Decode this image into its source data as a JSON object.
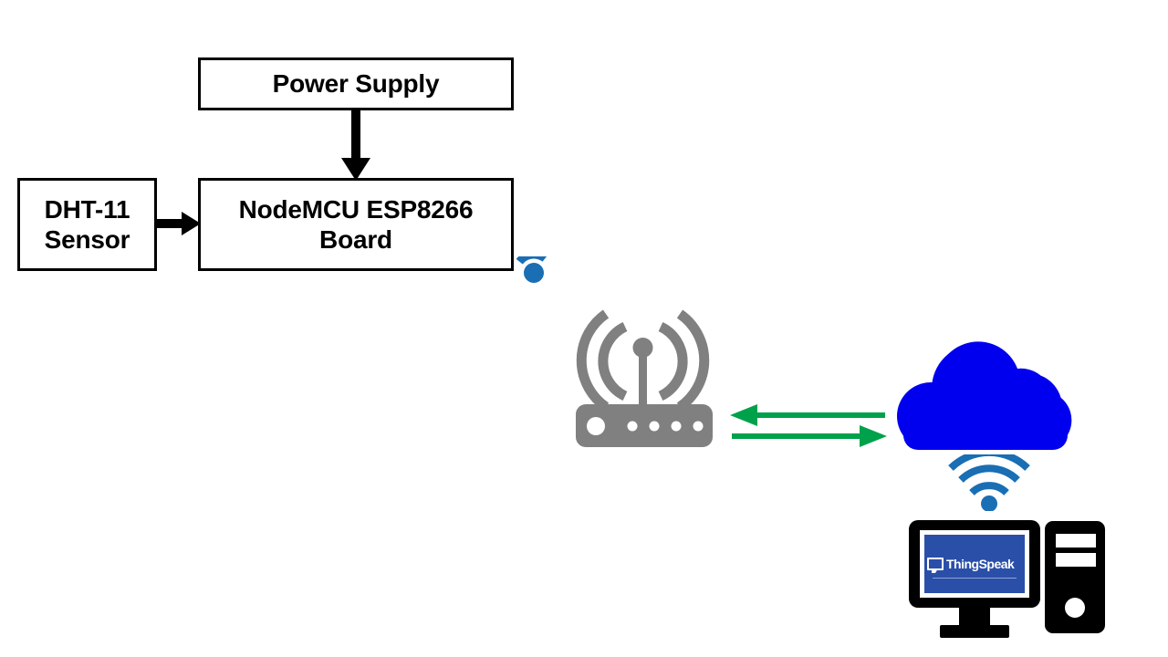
{
  "diagram": {
    "title": "IoT temperature and humidity monitoring block diagram",
    "background_color": "#ffffff",
    "blocks": [
      {
        "id": "power_supply",
        "label": "Power Supply",
        "border_color": "#000000",
        "fill_color": "#ffffff"
      },
      {
        "id": "dht11_sensor",
        "label": "DHT-11\nSensor",
        "border_color": "#000000",
        "fill_color": "#ffffff"
      },
      {
        "id": "nodemcu_board",
        "label": "NodeMCU ESP8266\nBoard",
        "border_color": "#000000",
        "fill_color": "#ffffff"
      }
    ],
    "connectors": [
      {
        "id": "power-to-nodemcu",
        "from": "power_supply",
        "to": "nodemcu_board",
        "direction": "down",
        "color": "#000000"
      },
      {
        "id": "dht-to-nodemcu",
        "from": "dht11_sensor",
        "to": "nodemcu_board",
        "direction": "right",
        "color": "#000000"
      },
      {
        "id": "cloud-to-router",
        "from": "thingspeak_cloud",
        "to": "wifi_router",
        "direction": "left",
        "color": "#00a14b"
      },
      {
        "id": "router-to-cloud",
        "from": "wifi_router",
        "to": "thingspeak_cloud",
        "direction": "right",
        "color": "#00a14b"
      }
    ],
    "icons": [
      {
        "id": "esp_wifi_signal",
        "name": "wifi-signal-icon",
        "color": "#1a6eb4",
        "arcs": 3
      },
      {
        "id": "wifi_router",
        "name": "wifi-router-icon",
        "color": "#808080",
        "antenna_arcs": 4,
        "status_lights": 5
      },
      {
        "id": "thingspeak_cloud",
        "name": "cloud-icon",
        "color": "#0000ee"
      },
      {
        "id": "cloud_wifi_signal",
        "name": "wifi-signal-icon",
        "color": "#1a6eb4",
        "arcs": 3
      },
      {
        "id": "desktop_monitor",
        "name": "computer-monitor-icon",
        "color": "#000000",
        "screen_color": "#2a4fa8"
      },
      {
        "id": "desktop_tower",
        "name": "computer-tower-icon",
        "color": "#000000"
      }
    ],
    "screen": {
      "app_name": "ThingSpeak",
      "logo_icon": "speech-bubble-icon",
      "screen_color": "#2a4fa8",
      "text_color": "#ffffff"
    },
    "colors": {
      "stroke_black": "#000000",
      "router_gray": "#808080",
      "wifi_blue": "#1a6eb4",
      "cloud_blue": "#0000ee",
      "arrow_green": "#00a14b",
      "screen_blue": "#2a4fa8"
    }
  }
}
